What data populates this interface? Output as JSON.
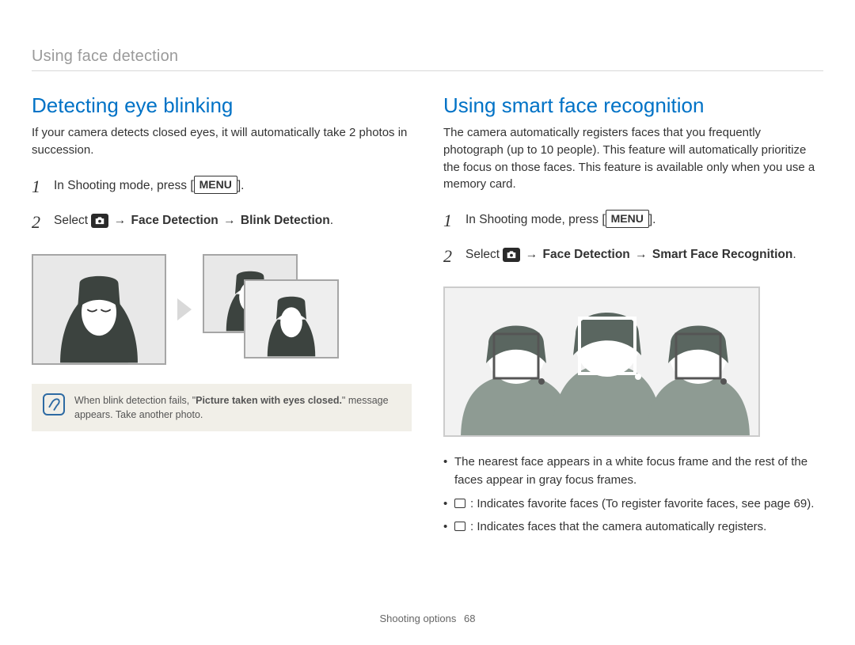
{
  "header": {
    "breadcrumb": "Using face detection"
  },
  "left": {
    "title": "Detecting eye blinking",
    "intro": "If your camera detects closed eyes, it will automatically take 2 photos in succession.",
    "steps": [
      {
        "num": "1",
        "prefix": "In Shooting mode, press [",
        "menu": "MENU",
        "suffix": "]."
      },
      {
        "num": "2",
        "select": "Select ",
        "arrow": "→",
        "path1": "Face Detection",
        "path2": "Blink Detection",
        "end": "."
      }
    ],
    "note_prefix": "When blink detection fails, \"",
    "note_bold": "Picture taken with eyes closed.",
    "note_suffix": "\" message appears. Take another photo."
  },
  "right": {
    "title": "Using smart face recognition",
    "intro": "The camera automatically registers faces that you frequently photograph (up to 10 people). This feature will automatically prioritize the focus on those faces. This feature is available only when you use a memory card.",
    "steps": [
      {
        "num": "1",
        "prefix": "In Shooting mode, press [",
        "menu": "MENU",
        "suffix": "]."
      },
      {
        "num": "2",
        "select": "Select ",
        "arrow": "→",
        "path1": "Face Detection",
        "path2": "Smart Face Recognition",
        "end": "."
      }
    ],
    "bullets": [
      "The nearest face appears in a white focus frame and the rest of the faces appear in gray focus frames.",
      ": Indicates favorite faces (To register favorite faces, see page 69).",
      ": Indicates faces that the camera automatically registers."
    ]
  },
  "footer": {
    "section": "Shooting options",
    "page": "68"
  }
}
